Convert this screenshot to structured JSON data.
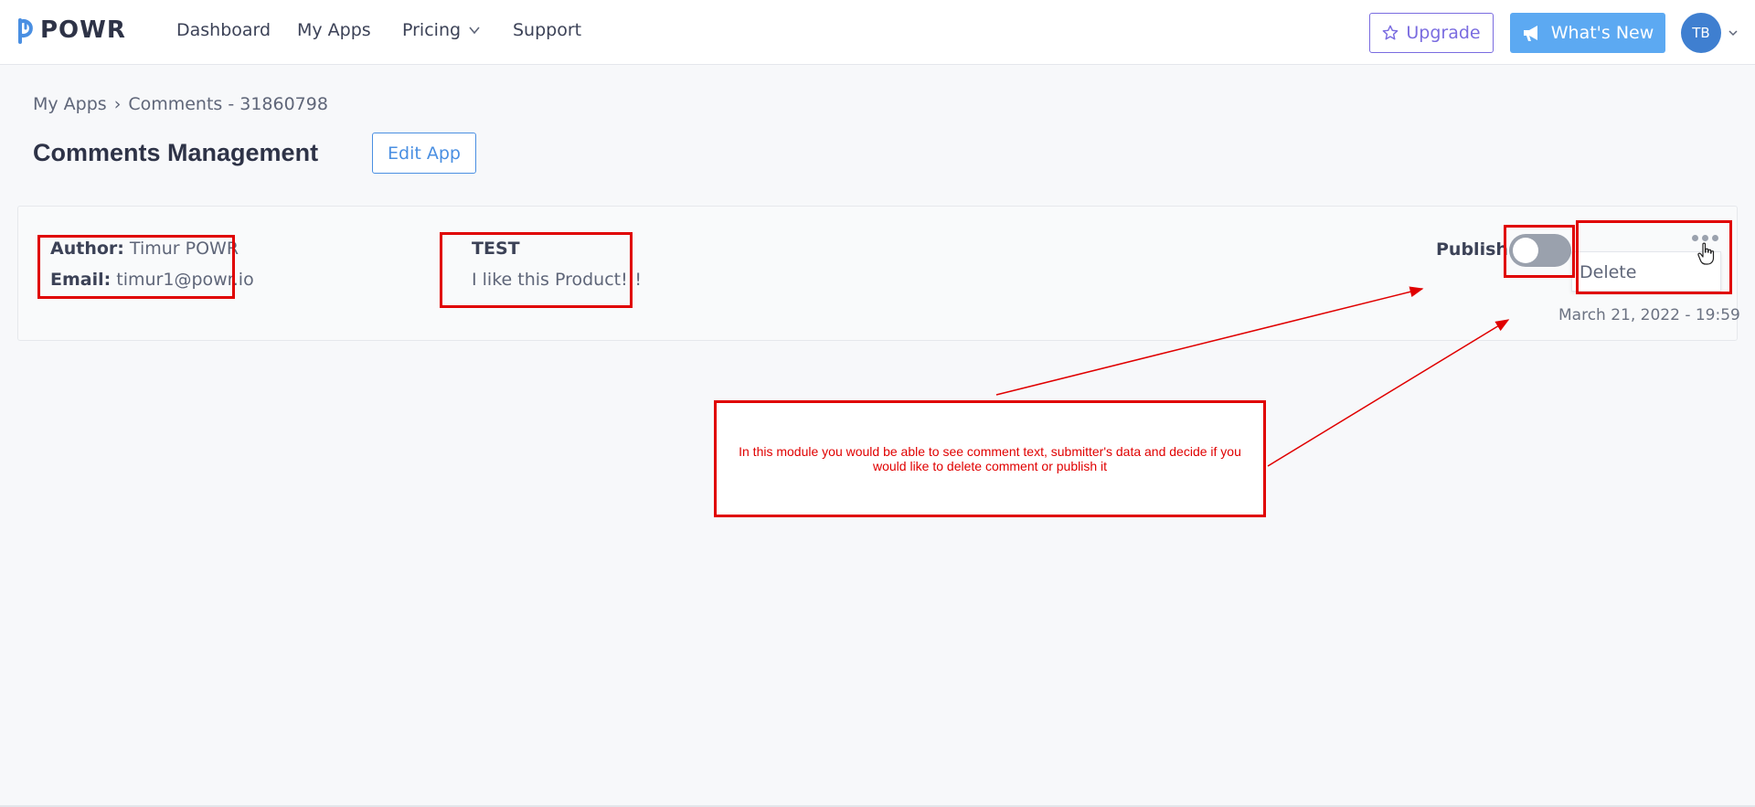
{
  "brand": {
    "name": "POWR"
  },
  "nav": {
    "dashboard": "Dashboard",
    "my_apps": "My Apps",
    "pricing": "Pricing",
    "support": "Support",
    "upgrade": "Upgrade",
    "whats_new": "What's New",
    "avatar_initials": "TB"
  },
  "breadcrumb": {
    "root": "My Apps",
    "separator": "›",
    "current": "Comments - 31860798"
  },
  "header": {
    "title": "Comments Management",
    "edit_button": "Edit App"
  },
  "comment": {
    "author_label": "Author:",
    "author": "Timur POWR",
    "email_label": "Email:",
    "email": "timur1@powr.io",
    "title": "TEST",
    "text": "I like this Product!!!",
    "publish_label": "Publish",
    "published": false,
    "menu_delete": "Delete",
    "date": "March 21, 2022 - 19:59"
  },
  "annotation": {
    "note": "In this module you would be able to see comment text, submitter's data and decide if you would like to delete comment or publish it",
    "color": "#e00000"
  },
  "colors": {
    "accent_blue": "#4a8fe2",
    "upgrade_purple": "#7a6ce0",
    "whats_new_bg": "#5ca9f2",
    "avatar_bg": "#3f7fd0"
  }
}
